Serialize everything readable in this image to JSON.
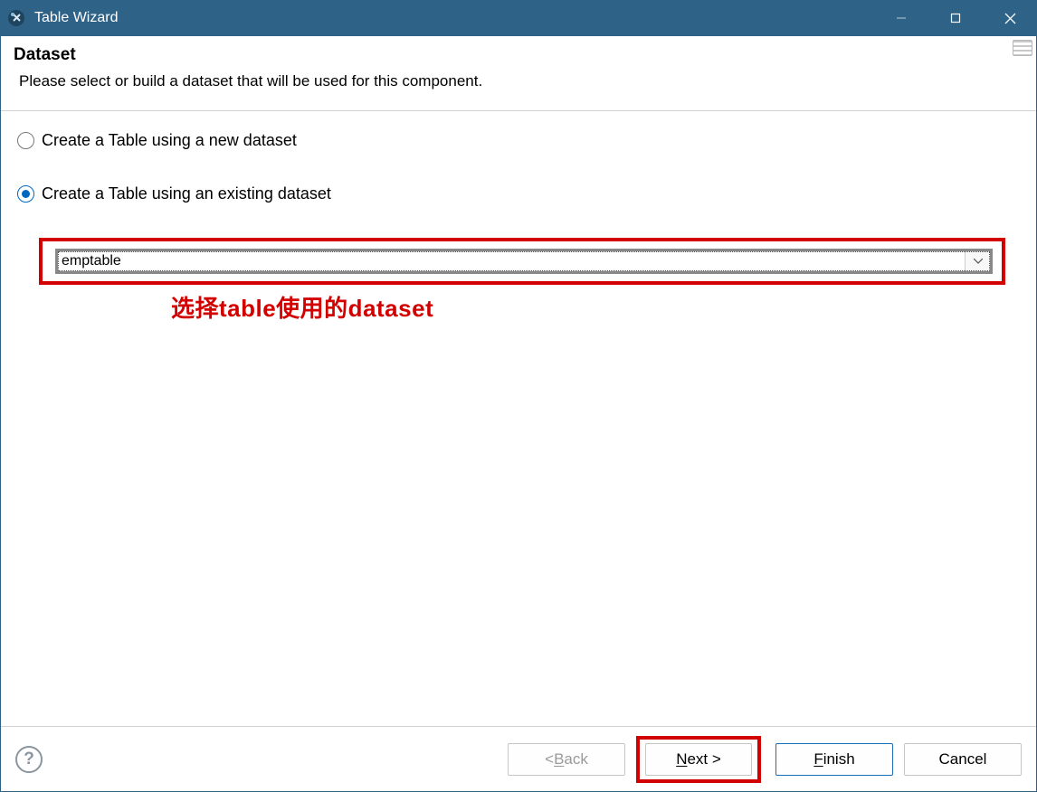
{
  "window": {
    "title": "Table Wizard"
  },
  "header": {
    "title": "Dataset",
    "subtitle": "Please select or build a dataset that will be used for this component."
  },
  "options": {
    "new_dataset": {
      "label": "Create a Table using a new dataset",
      "selected": false
    },
    "existing_dataset": {
      "label": "Create a Table using an existing dataset",
      "selected": true
    }
  },
  "dropdown": {
    "value": "emptable"
  },
  "annotation": {
    "text": "选择table使用的dataset"
  },
  "footer": {
    "back": {
      "prefix": "< ",
      "u": "B",
      "rest": "ack"
    },
    "next": {
      "u": "N",
      "rest": "ext >"
    },
    "finish": {
      "u": "F",
      "rest": "inish"
    },
    "cancel": "Cancel"
  }
}
